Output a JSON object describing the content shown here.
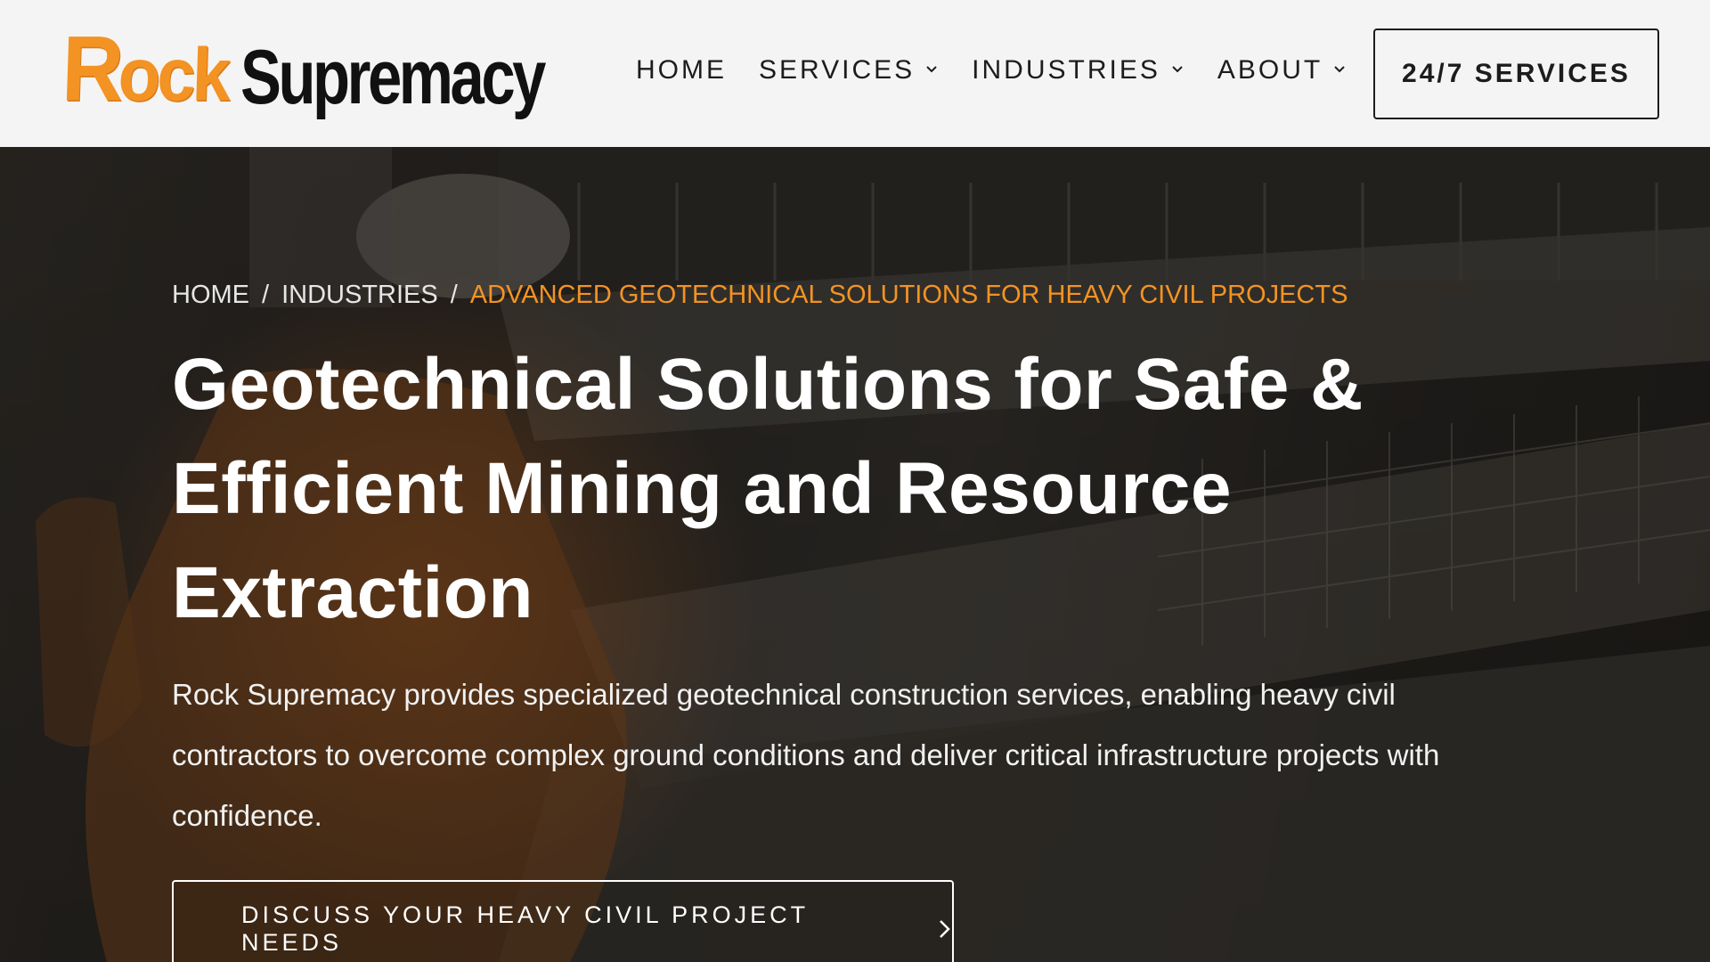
{
  "header": {
    "logo": {
      "part1": "Rock",
      "part2": "Supremacy",
      "accent_color": "#f39323"
    },
    "nav": [
      {
        "label": "HOME",
        "has_dropdown": false
      },
      {
        "label": "SERVICES",
        "has_dropdown": true
      },
      {
        "label": "INDUSTRIES",
        "has_dropdown": true
      },
      {
        "label": "ABOUT",
        "has_dropdown": true
      }
    ],
    "cta_label": "24/7 SERVICES"
  },
  "hero": {
    "breadcrumb": {
      "home": "HOME",
      "industries": "INDUSTRIES",
      "current": "ADVANCED GEOTECHNICAL SOLUTIONS FOR HEAVY CIVIL PROJECTS",
      "separator": "/"
    },
    "title": "Geotechnical Solutions for Safe & Efficient Mining and Resource Extraction",
    "description": "Rock Supremacy provides specialized geotechnical construction services, enabling heavy civil contractors to overcome complex ground conditions and deliver critical infrastructure projects with confidence.",
    "cta_label": "DISCUSS YOUR HEAVY CIVIL PROJECT NEEDS"
  },
  "icons": {
    "dropdown": "chevron-down-icon",
    "cta_arrow": "chevron-right-icon"
  }
}
